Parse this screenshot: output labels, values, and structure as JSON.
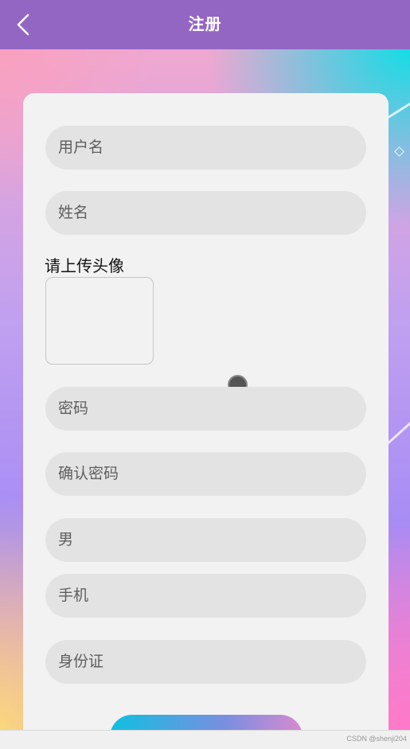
{
  "header": {
    "title": "注册",
    "back_icon": "chevron-left-icon",
    "background": "#9466c4"
  },
  "form": {
    "username_placeholder": "用户名",
    "name_placeholder": "姓名",
    "avatar_label": "请上传头像",
    "password_placeholder": "密码",
    "confirm_password_placeholder": "确认密码",
    "gender_value": "男",
    "phone_placeholder": "手机",
    "id_card_placeholder": "身份证"
  },
  "footer": {
    "watermark": "CSDN @shenji204"
  }
}
